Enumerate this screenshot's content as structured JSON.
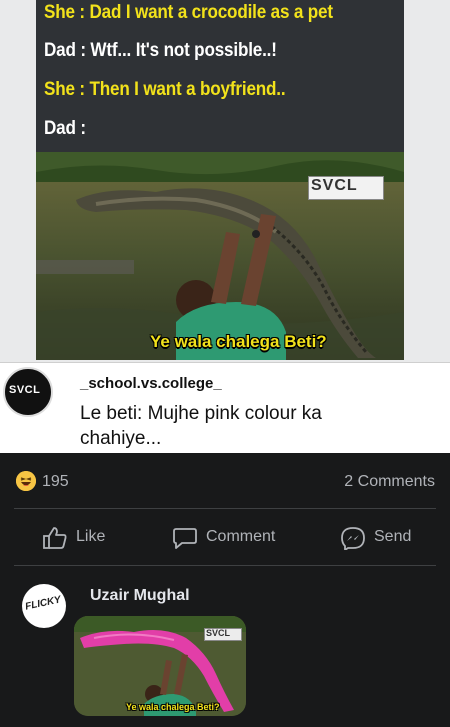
{
  "meme": {
    "lines": [
      "She : Dad I want a crocodile as a pet",
      "Dad : Wtf... It's not possible..!",
      "She : Then I want a boyfriend..",
      "Dad :"
    ],
    "watermark": "SVCL",
    "image_caption": "Ye wala chalega Beti?"
  },
  "post": {
    "avatar_text": "SVCL",
    "username": "_school.vs.college_",
    "text": "Le beti: Mujhe pink colour ka chahiye..."
  },
  "reactions": {
    "icon": "haha-emoji-icon",
    "count": "195",
    "comments": "2 Comments"
  },
  "actions": {
    "like": "Like",
    "comment": "Comment",
    "send": "Send"
  },
  "comment": {
    "avatar_text": "FLICKY",
    "author": "Uzair Mughal",
    "image_watermark": "SVCL",
    "image_caption": "Ye wala chalega Beti?"
  },
  "colors": {
    "background": "#18191a",
    "caption_yellow": "#f2e21b",
    "muted_text": "#b0b3b8"
  }
}
